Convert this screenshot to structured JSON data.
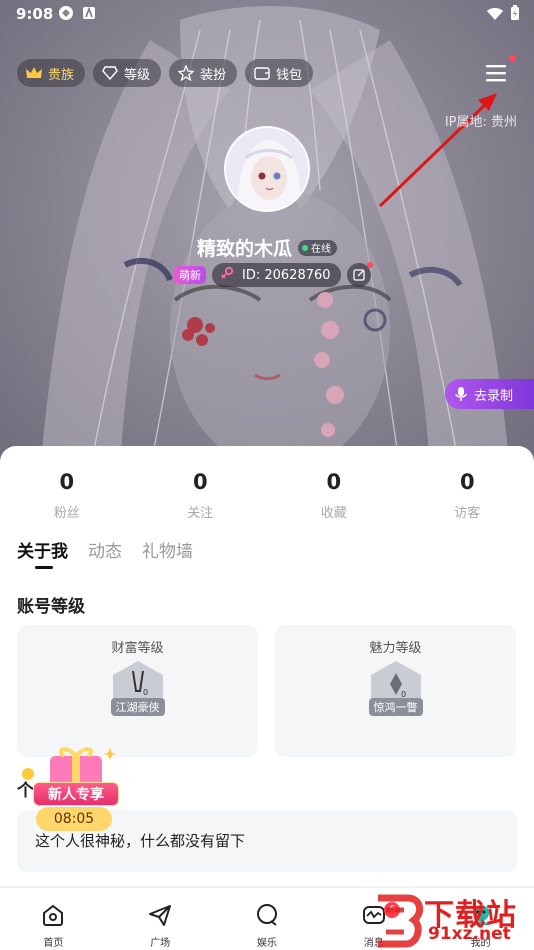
{
  "status_bar": {
    "time": "9:08"
  },
  "top_chips": [
    {
      "label": "贵族",
      "icon": "crown-icon"
    },
    {
      "label": "等级",
      "icon": "diamond-icon"
    },
    {
      "label": "装扮",
      "icon": "star-outline-icon"
    },
    {
      "label": "钱包",
      "icon": "wallet-icon"
    }
  ],
  "ip_location": "IP属地: 贵州",
  "profile": {
    "nickname": "精致的木瓜",
    "online_status": "在线",
    "tag": "萌新",
    "id_text": "ID: 20628760"
  },
  "record_button": "去录制",
  "stats": [
    {
      "value": "0",
      "label": "粉丝"
    },
    {
      "value": "0",
      "label": "关注"
    },
    {
      "value": "0",
      "label": "收藏"
    },
    {
      "value": "0",
      "label": "访客"
    }
  ],
  "tabs": [
    {
      "label": "关于我",
      "active": true
    },
    {
      "label": "动态",
      "active": false
    },
    {
      "label": "礼物墙",
      "active": false
    }
  ],
  "account_level": {
    "title": "账号等级",
    "wealth": {
      "title": "财富等级",
      "rank": "江湖豪侠",
      "level": "0"
    },
    "charm": {
      "title": "魅力等级",
      "rank": "惊鸿一瞥",
      "level": "0"
    }
  },
  "intro": {
    "title": "个",
    "text": "这个人很神秘，什么都没有留下"
  },
  "promo": {
    "label": "新人专享",
    "timer": "08:05"
  },
  "bottom_nav": [
    {
      "label": "首页",
      "icon": "home-icon"
    },
    {
      "label": "广场",
      "icon": "send-icon"
    },
    {
      "label": "娱乐",
      "icon": "chat-bubble-icon"
    },
    {
      "label": "消息",
      "icon": "message-icon",
      "badge": "6"
    },
    {
      "label": "我的",
      "icon": "profile-icon"
    }
  ],
  "watermark": {
    "main": "下载站",
    "sub": "91xz.net"
  },
  "colors": {
    "accent_purple": "#9b45e4",
    "alert_red": "#ff3b4f",
    "tag_pink": "#e95bd6"
  }
}
